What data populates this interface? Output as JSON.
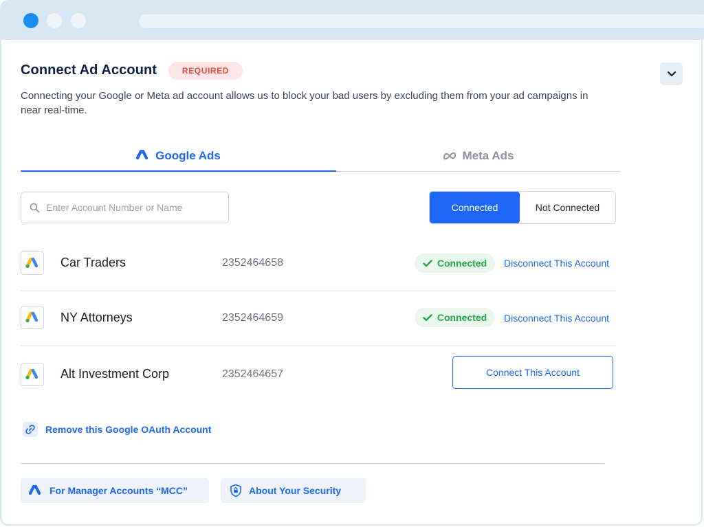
{
  "header": {
    "title": "Connect Ad Account",
    "required_badge": "REQUIRED",
    "description": "Connecting your Google or Meta ad account allows us to block your bad users by excluding them from your ad campaigns in near real-time."
  },
  "tabs": [
    {
      "label": "Google Ads",
      "active": true,
      "icon": "google-ads-icon"
    },
    {
      "label": "Meta Ads",
      "active": false,
      "icon": "meta-icon"
    }
  ],
  "search": {
    "placeholder": "Enter Account Number or Name",
    "value": ""
  },
  "filter": {
    "connected": "Connected",
    "not_connected": "Not Connected",
    "selected": "Connected"
  },
  "accounts": [
    {
      "name": "Car Traders",
      "number": "2352464658",
      "status": "Connected",
      "action": "Disconnect This Account"
    },
    {
      "name": "NY Attorneys",
      "number": "2352464659",
      "status": "Connected",
      "action": "Disconnect This Account"
    },
    {
      "name": "Alt Investment Corp",
      "number": "2352464657",
      "status": "",
      "action": "Connect This Account"
    }
  ],
  "remove_oauth": "Remove this Google OAuth Account",
  "footer": {
    "mcc": "For Manager Accounts “MCC”",
    "security": "About Your Security"
  },
  "colors": {
    "accent": "#1e66f5",
    "success": "#21a84a",
    "required": "#e0483e"
  }
}
